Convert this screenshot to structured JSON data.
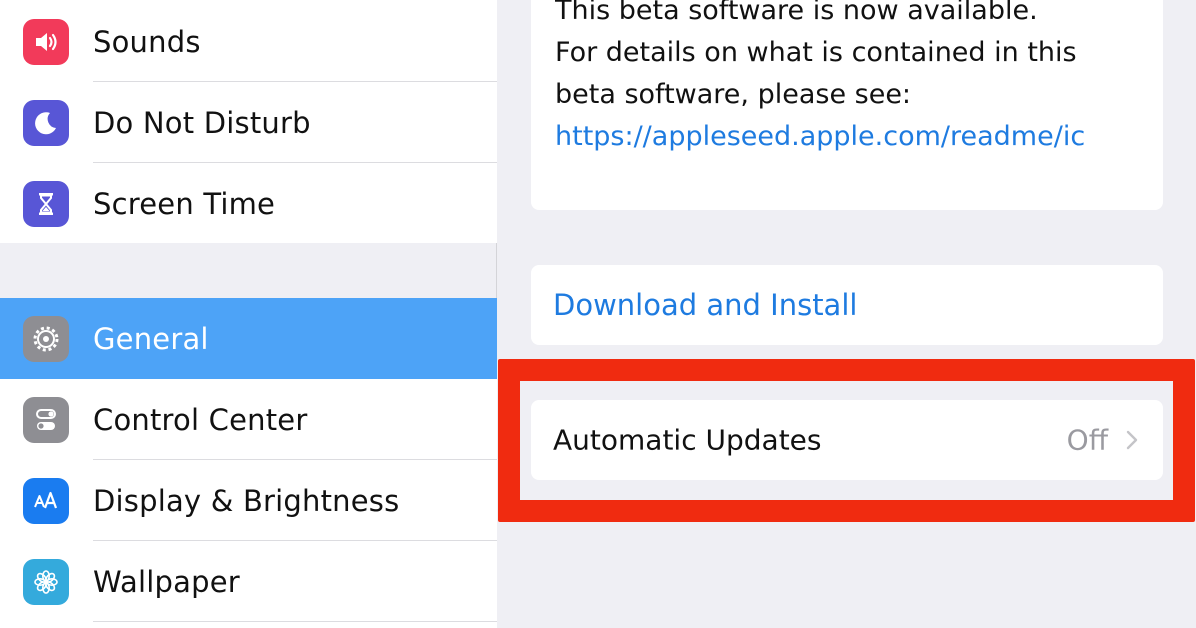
{
  "sidebar": {
    "items": [
      {
        "label": "Sounds",
        "icon": "speaker-icon",
        "color": "#f23a5a"
      },
      {
        "label": "Do Not Disturb",
        "icon": "moon-icon",
        "color": "#5856d6"
      },
      {
        "label": "Screen Time",
        "icon": "hourglass-icon",
        "color": "#5856d6"
      },
      {
        "label": "General",
        "icon": "gear-icon",
        "color": "#8e8e93",
        "selected": true
      },
      {
        "label": "Control Center",
        "icon": "toggles-icon",
        "color": "#8e8e93"
      },
      {
        "label": "Display & Brightness",
        "icon": "text-size-icon",
        "color": "#1a7cf0"
      },
      {
        "label": "Wallpaper",
        "icon": "flower-icon",
        "color": "#34aadc"
      }
    ]
  },
  "detail": {
    "description_lines": [
      "This beta software is now available.",
      "For details on what is contained in this",
      "beta software, please see:"
    ],
    "link": "https://appleseed.apple.com/readme/ic",
    "download_label": "Download and Install",
    "auto_updates": {
      "label": "Automatic Updates",
      "value": "Off"
    }
  },
  "colors": {
    "accent": "#1e7be0",
    "selected_row": "#4da3f7",
    "highlight": "#f02b10"
  }
}
